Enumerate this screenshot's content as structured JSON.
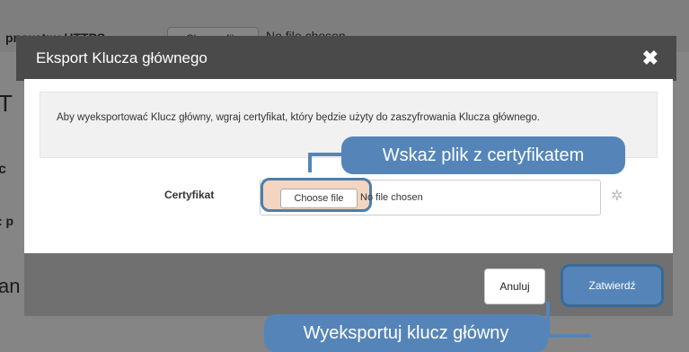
{
  "background": {
    "label": "prywatny HTTPS",
    "choose_label": "Choose file",
    "no_file": "No file chosen"
  },
  "modal": {
    "title": "Eksport Klucza głównego",
    "close_symbol": "✖",
    "info_text": "Aby wyeksportować Klucz główny, wgraj certyfikat, który będzie użyty do zaszyfrowania Klucza głównego.",
    "cert_label": "Certyfikat",
    "choose_file_label": "Choose file",
    "no_file_label": "No file chosen",
    "gear_icon": "✲",
    "cancel_label": "Anuluj",
    "submit_label": "Zatwierdź"
  },
  "callouts": {
    "file": "Wskaż plik z certyfikatem",
    "export": "Wyeksportuj klucz główny"
  },
  "colors": {
    "accent": "#5585b8",
    "header": "#4a4a4a",
    "footer": "#707070"
  }
}
